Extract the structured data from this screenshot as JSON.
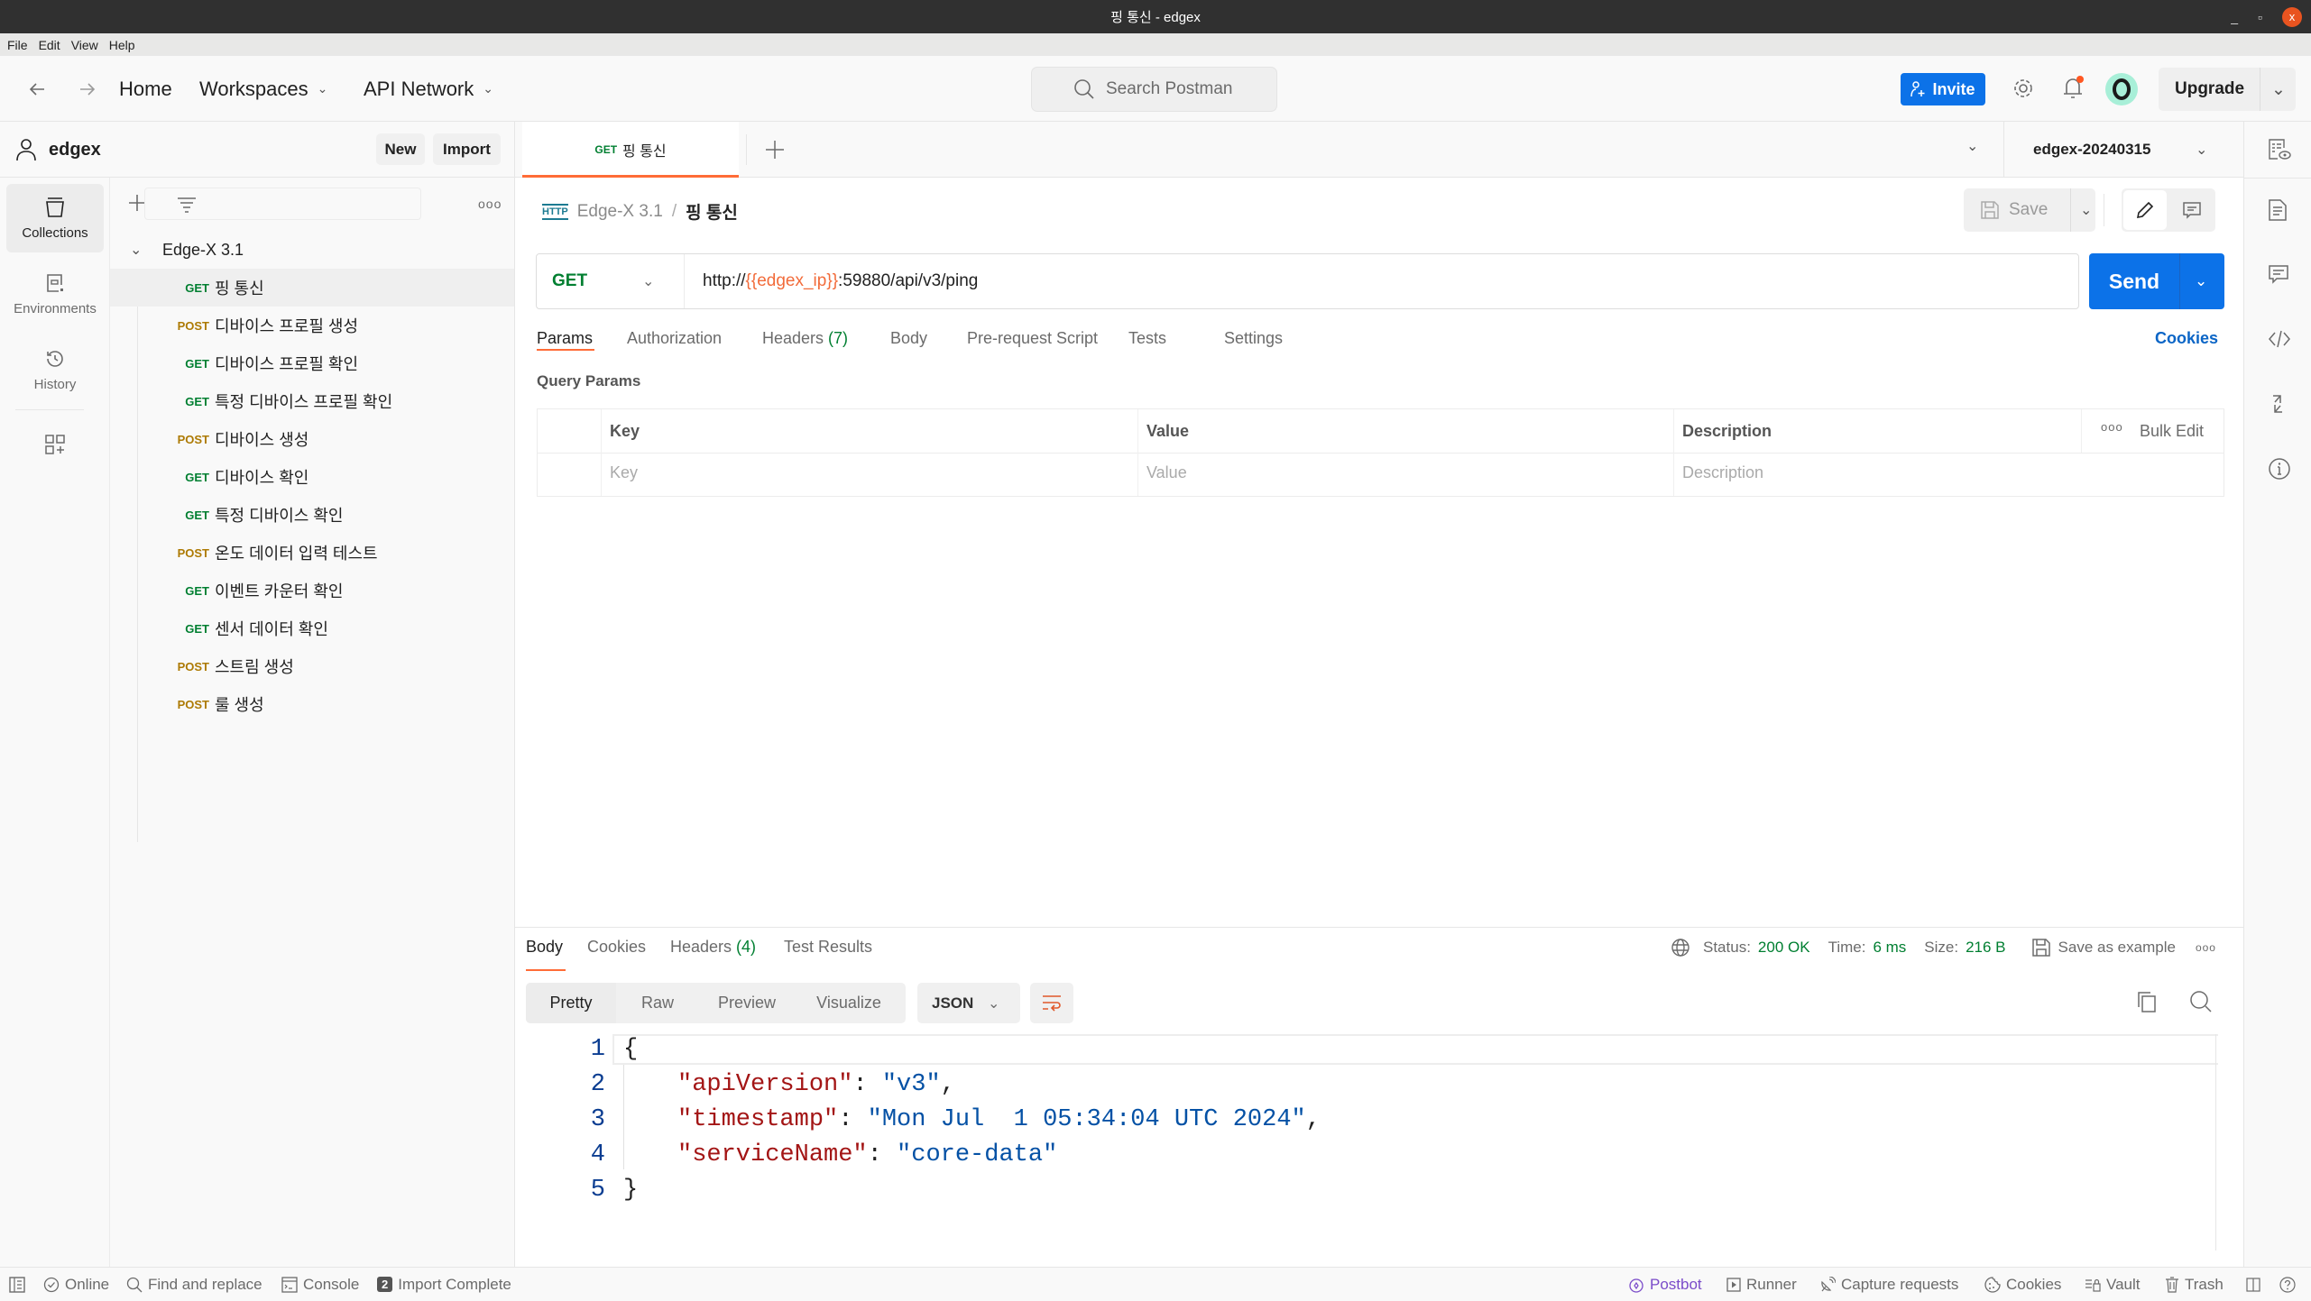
{
  "window": {
    "title": "핑 통신 - edgex",
    "controls": {
      "minimize": "_",
      "maximize": "▫",
      "close": "x"
    }
  },
  "menu": [
    "File",
    "Edit",
    "View",
    "Help"
  ],
  "header": {
    "home": "Home",
    "workspaces": "Workspaces",
    "api_network": "API Network",
    "search_placeholder": "Search Postman",
    "invite": "Invite",
    "upgrade": "Upgrade"
  },
  "sidebar": {
    "workspace_name": "edgex",
    "new_label": "New",
    "import_label": "Import",
    "rail": [
      {
        "label": "Collections",
        "icon": "collections-icon",
        "active": true
      },
      {
        "label": "Environments",
        "icon": "environments-icon"
      },
      {
        "label": "History",
        "icon": "history-icon"
      }
    ],
    "collection": {
      "name": "Edge-X 3.1",
      "requests": [
        {
          "method": "GET",
          "name": "핑 통신",
          "selected": true
        },
        {
          "method": "POST",
          "name": "디바이스 프로필 생성"
        },
        {
          "method": "GET",
          "name": "디바이스 프로필 확인"
        },
        {
          "method": "GET",
          "name": "특정 디바이스 프로필 확인"
        },
        {
          "method": "POST",
          "name": "디바이스 생성"
        },
        {
          "method": "GET",
          "name": "디바이스 확인"
        },
        {
          "method": "GET",
          "name": "특정 디바이스 확인"
        },
        {
          "method": "POST",
          "name": "온도 데이터 입력 테스트"
        },
        {
          "method": "GET",
          "name": "이벤트 카운터 확인"
        },
        {
          "method": "GET",
          "name": "센서 데이터 확인"
        },
        {
          "method": "POST",
          "name": "스트림 생성"
        },
        {
          "method": "POST",
          "name": "룰 생성"
        }
      ]
    }
  },
  "tab": {
    "method": "GET",
    "name": "핑 통신"
  },
  "environment": "edgex-20240315",
  "breadcrumb": {
    "icon": "HTTP",
    "collection": "Edge-X 3.1",
    "separator": "/",
    "request": "핑 통신"
  },
  "request": {
    "method": "GET",
    "url_prefix": "http://",
    "url_variable": "{{edgex_ip}}",
    "url_suffix": ":59880/api/v3/ping",
    "save_label": "Save",
    "send_label": "Send",
    "tabs": [
      {
        "label": "Params",
        "active": true
      },
      {
        "label": "Authorization"
      },
      {
        "label": "Headers",
        "count": "(7)"
      },
      {
        "label": "Body"
      },
      {
        "label": "Pre-request Script"
      },
      {
        "label": "Tests"
      },
      {
        "label": "Settings"
      }
    ],
    "cookies_link": "Cookies",
    "query_params_title": "Query Params",
    "table": {
      "headers": [
        "Key",
        "Value",
        "Description"
      ],
      "placeholders": [
        "Key",
        "Value",
        "Description"
      ],
      "bulk_edit": "Bulk Edit"
    }
  },
  "response": {
    "tabs": [
      {
        "label": "Body",
        "active": true
      },
      {
        "label": "Cookies"
      },
      {
        "label": "Headers",
        "count": "(4)"
      },
      {
        "label": "Test Results"
      }
    ],
    "status_label": "Status:",
    "status": "200 OK",
    "time_label": "Time:",
    "time": "6 ms",
    "size_label": "Size:",
    "size": "216 B",
    "save_example": "Save as example",
    "views": [
      "Pretty",
      "Raw",
      "Preview",
      "Visualize"
    ],
    "format": "JSON",
    "body_lines": [
      {
        "n": "1",
        "text": "{"
      },
      {
        "n": "2",
        "key": "\"apiVersion\"",
        "value": "\"v3\"",
        "trail": ","
      },
      {
        "n": "3",
        "key": "\"timestamp\"",
        "value": "\"Mon Jul  1 05:34:04 UTC 2024\"",
        "trail": ","
      },
      {
        "n": "4",
        "key": "\"serviceName\"",
        "value": "\"core-data\"",
        "trail": ""
      },
      {
        "n": "5",
        "text": "}"
      }
    ]
  },
  "statusbar": {
    "online": "Online",
    "find_replace": "Find and replace",
    "console": "Console",
    "import_badge": "2",
    "import_status": "Import Complete",
    "postbot": "Postbot",
    "runner": "Runner",
    "capture": "Capture requests",
    "cookies": "Cookies",
    "vault": "Vault",
    "trash": "Trash"
  },
  "colors": {
    "accent": "#ff6c37",
    "primary": "#0c72e8",
    "get": "#007f31",
    "post": "#ad7a03",
    "success": "#007f31"
  }
}
